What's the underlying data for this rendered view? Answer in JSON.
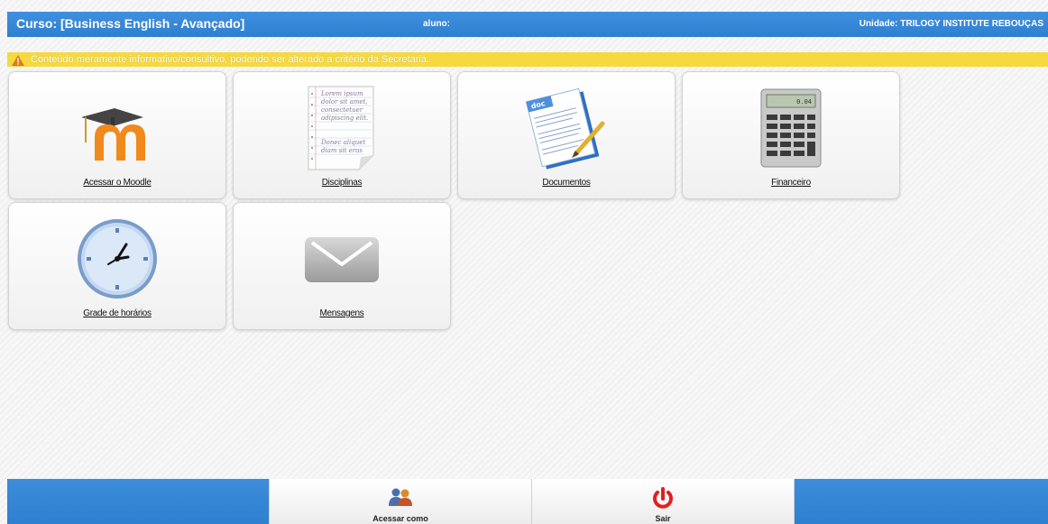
{
  "header": {
    "course": "Curso: [Business English - Avançado]",
    "student": "aluno:",
    "unit": "Unidade: TRILOGY INSTITUTE REBOUÇAS"
  },
  "notice": {
    "icon": "warning-icon",
    "text": "Conteúdo meramente informativo/consultivo, podendo ser alterado a critério da Secretaria."
  },
  "tiles": [
    {
      "label": "Acessar o Moodle",
      "icon": "moodle-icon"
    },
    {
      "label": "Disciplinas",
      "icon": "notepad-icon"
    },
    {
      "label": "Documentos",
      "icon": "document-icon"
    },
    {
      "label": "Financeiro",
      "icon": "calculator-icon"
    },
    {
      "label": "Grade de horários",
      "icon": "clock-icon"
    },
    {
      "label": "Mensagens",
      "icon": "envelope-icon"
    }
  ],
  "notepad_lines": [
    "Lorem ipsum",
    "dolor sit amet,",
    "consectetuer",
    "adipiscing elit.",
    "Donec aliquet",
    "diam sit eros"
  ],
  "calculator_display": "0.04",
  "footer": {
    "switch_user_label": "Acessar como",
    "logout_label": "Sair"
  },
  "colors": {
    "accent": "#3a87d6",
    "warning": "#f5d93f",
    "logout": "#e02020"
  }
}
